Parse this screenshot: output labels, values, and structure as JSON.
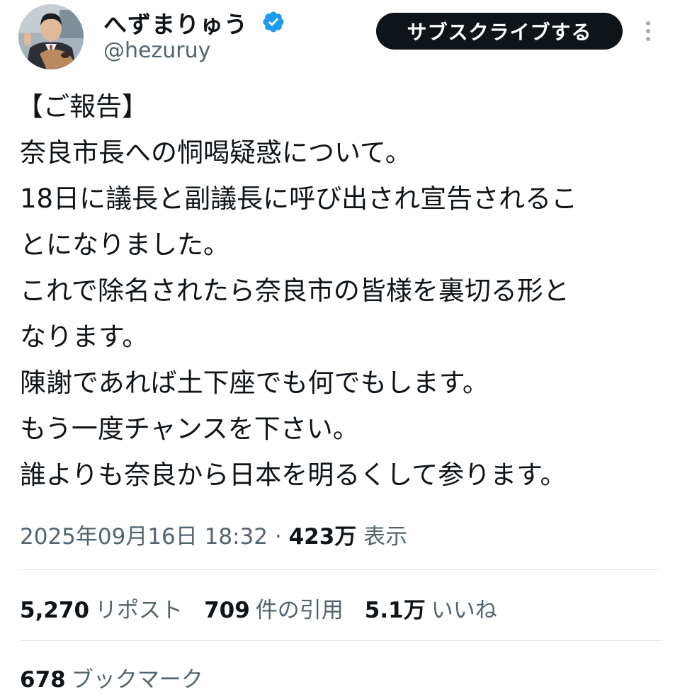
{
  "author": {
    "display_name": "へずまりゅう",
    "handle": "@hezuruy",
    "verified_icon": "verified-badge-icon",
    "verified_color": "#1d9bf0",
    "avatar_icon": "profile-photo"
  },
  "actions": {
    "subscribe_label": "サブスクライブする",
    "more_icon": "more-options-icon"
  },
  "tweet": {
    "lines": [
      "【ご報告】",
      "奈良市長への恫喝疑惑について。",
      "18日に議長と副議長に呼び出され宣告されるこ",
      "とになりました。",
      "これで除名されたら奈良市の皆様を裏切る形と",
      "なります。",
      "陳謝であれば土下座でも何でもします。",
      "もう一度チャンスを下さい。",
      "誰よりも奈良から日本を明るくして参ります。"
    ]
  },
  "meta": {
    "timestamp": "2025年09月16日 18:32",
    "separator": "·",
    "views_count": "423万",
    "views_label": "表示"
  },
  "stats": {
    "reposts": {
      "count": "5,270",
      "label": "リポスト"
    },
    "quotes": {
      "count": "709",
      "label": "件の引用"
    },
    "likes": {
      "count": "5.1万",
      "label": "いいね"
    },
    "bookmarks": {
      "count": "678",
      "label": "ブックマーク"
    }
  },
  "colors": {
    "text_primary": "#0f1419",
    "text_secondary": "#536471",
    "button_bg": "#0f1419",
    "button_text": "#ffffff",
    "divider": "#e1e6ea"
  }
}
